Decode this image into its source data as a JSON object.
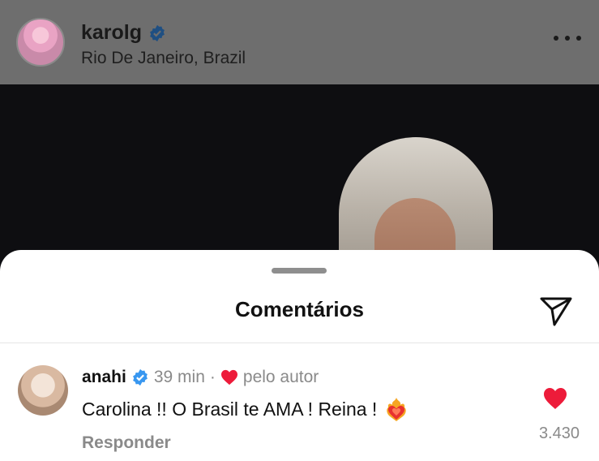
{
  "post": {
    "username": "karolg",
    "location": "Rio De Janeiro, Brazil"
  },
  "comments_sheet": {
    "title": "Comentários"
  },
  "comment": {
    "username": "anahi",
    "time": "39 min",
    "separator": "·",
    "liked_by_author": "pelo autor",
    "text": "Carolina !! O Brasil te AMA ! Reina !",
    "reply_label": "Responder",
    "like_count": "3.430"
  },
  "colors": {
    "verified_blue": "#3897f0",
    "like_red": "#ed1b3a"
  },
  "icons": {
    "verified": "verified-badge-icon",
    "more": "more-options-icon",
    "send": "send-icon",
    "heart": "heart-icon",
    "heart_on_fire": "heart-on-fire-icon"
  }
}
